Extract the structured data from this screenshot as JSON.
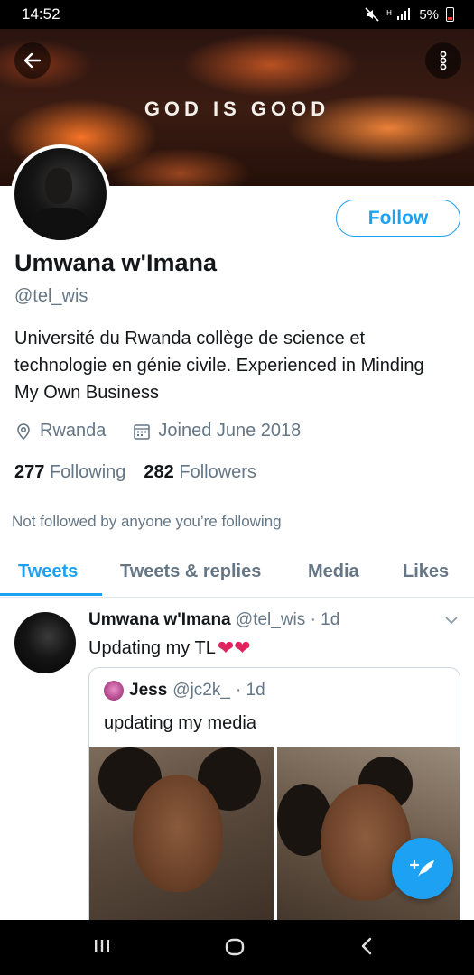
{
  "status_bar": {
    "time": "14:52",
    "battery": "5%"
  },
  "banner": {
    "text": "GOD IS GOOD"
  },
  "profile": {
    "follow_label": "Follow",
    "display_name": "Umwana w'Imana",
    "handle": "@tel_wis",
    "bio": "Université du Rwanda collège de science et technologie en génie civile.  Experienced in Minding My Own Business",
    "location": "Rwanda",
    "joined": "Joined June 2018",
    "following_count": "277",
    "following_label": "Following",
    "followers_count": "282",
    "followers_label": "Followers",
    "not_followed_note": "Not followed by anyone you’re following"
  },
  "tabs": [
    {
      "label": "Tweets",
      "active": true
    },
    {
      "label": "Tweets & replies",
      "active": false
    },
    {
      "label": "Media",
      "active": false
    },
    {
      "label": "Likes",
      "active": false
    }
  ],
  "tweet": {
    "name": "Umwana w'Imana",
    "handle": "@tel_wis",
    "time": "· 1d",
    "text": "Updating my TL",
    "emoji": "❤❤",
    "quote": {
      "name": "Jess",
      "handle": "@jc2k_",
      "time": "· 1d",
      "text": "updating my media"
    }
  },
  "colors": {
    "accent": "#1da1f2",
    "muted": "#657786",
    "text": "#14171a",
    "heart": "#e0245e"
  },
  "icons": [
    "back-arrow-icon",
    "more-vertical-icon",
    "location-pin-icon",
    "calendar-icon",
    "chevron-down-icon",
    "compose-tweet-icon",
    "recent-apps-icon",
    "home-icon",
    "back-nav-icon",
    "mute-icon",
    "signal-icon"
  ]
}
